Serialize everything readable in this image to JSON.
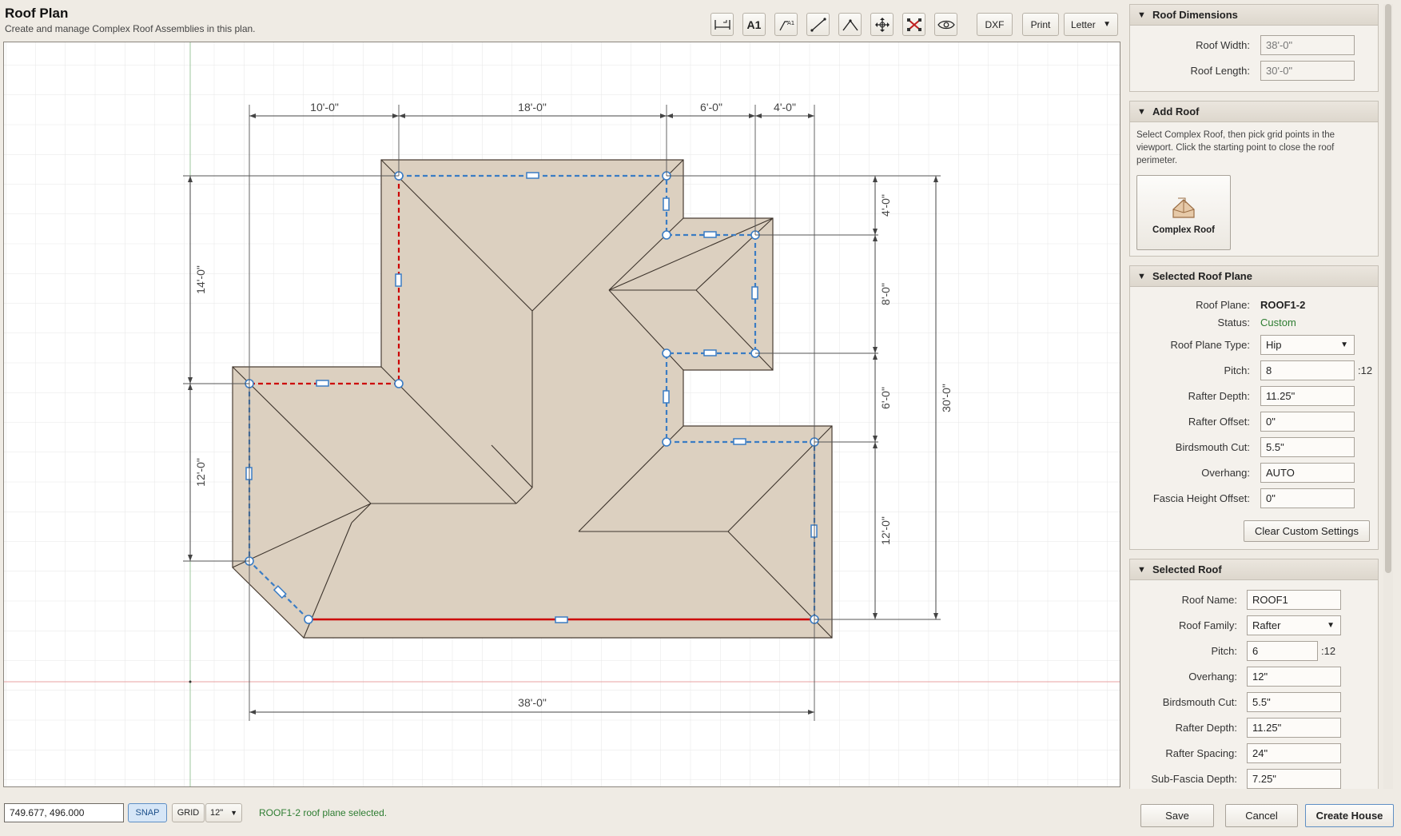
{
  "header": {
    "title": "Roof Plan",
    "subtitle": "Create and manage Complex Roof Assemblies in this plan."
  },
  "toolbar": {
    "text_label": "A1",
    "dxf_label": "DXF",
    "print_label": "Print",
    "paper_size": "Letter"
  },
  "viewport": {
    "dim_top": [
      "10'-0\"",
      "18'-0\"",
      "6'-0\"",
      "4'-0\""
    ],
    "dim_left": [
      "14'-0\"",
      "12'-0\""
    ],
    "dim_right": [
      "4'-0\"",
      "8'-0\"",
      "6'-0\"",
      "12'-0\""
    ],
    "dim_total_right": "30'-0\"",
    "dim_bottom": "38'-0\""
  },
  "roof_dimensions": {
    "title": "Roof Dimensions",
    "width_label": "Roof Width:",
    "width_value": "38'-0\"",
    "length_label": "Roof Length:",
    "length_value": "30'-0\""
  },
  "add_roof": {
    "title": "Add Roof",
    "instructions": "Select Complex Roof, then pick grid points in the viewport. Click the starting point to close the roof perimeter.",
    "complex_roof_label": "Complex Roof"
  },
  "selected_plane": {
    "title": "Selected Roof Plane",
    "plane_label": "Roof Plane:",
    "plane_value": "ROOF1-2",
    "status_label": "Status:",
    "status_value": "Custom",
    "type_label": "Roof Plane Type:",
    "type_value": "Hip",
    "pitch_label": "Pitch:",
    "pitch_value": "8",
    "pitch_suffix": ":12",
    "rafter_depth_label": "Rafter Depth:",
    "rafter_depth_value": "11.25\"",
    "rafter_offset_label": "Rafter Offset:",
    "rafter_offset_value": "0\"",
    "birdsmouth_label": "Birdsmouth Cut:",
    "birdsmouth_value": "5.5\"",
    "overhang_label": "Overhang:",
    "overhang_value": "AUTO",
    "fascia_label": "Fascia Height Offset:",
    "fascia_value": "0\"",
    "clear_label": "Clear Custom Settings"
  },
  "selected_roof": {
    "title": "Selected Roof",
    "name_label": "Roof Name:",
    "name_value": "ROOF1",
    "family_label": "Roof Family:",
    "family_value": "Rafter",
    "pitch_label": "Pitch:",
    "pitch_value": "6",
    "pitch_suffix": ":12",
    "overhang_label": "Overhang:",
    "overhang_value": "12\"",
    "birdsmouth_label": "Birdsmouth Cut:",
    "birdsmouth_value": "5.5\"",
    "rafter_depth_label": "Rafter Depth:",
    "rafter_depth_value": "11.25\"",
    "rafter_spacing_label": "Rafter Spacing:",
    "rafter_spacing_value": "24\"",
    "subfascia_label": "Sub-Fascia Depth:",
    "subfascia_value": "7.25\""
  },
  "footer": {
    "coordinates": "749.677, 496.000",
    "snap_label": "SNAP",
    "grid_label": "GRID",
    "grid_value": "12\"",
    "status": "ROOF1-2 roof plane selected.",
    "save_label": "Save",
    "cancel_label": "Cancel",
    "create_label": "Create House"
  },
  "colors": {
    "accent": "#2e7d32",
    "roof_fill": "#dcd0c0",
    "selected_edge": "#cc0000",
    "edge": "#3a7cc4"
  },
  "icons": [
    "dimension-icon",
    "text-label-icon",
    "leader-icon",
    "line-icon",
    "angle-icon",
    "move-icon",
    "delete-icon",
    "visibility-icon",
    "complex-roof-icon",
    "chevron-down-icon"
  ]
}
